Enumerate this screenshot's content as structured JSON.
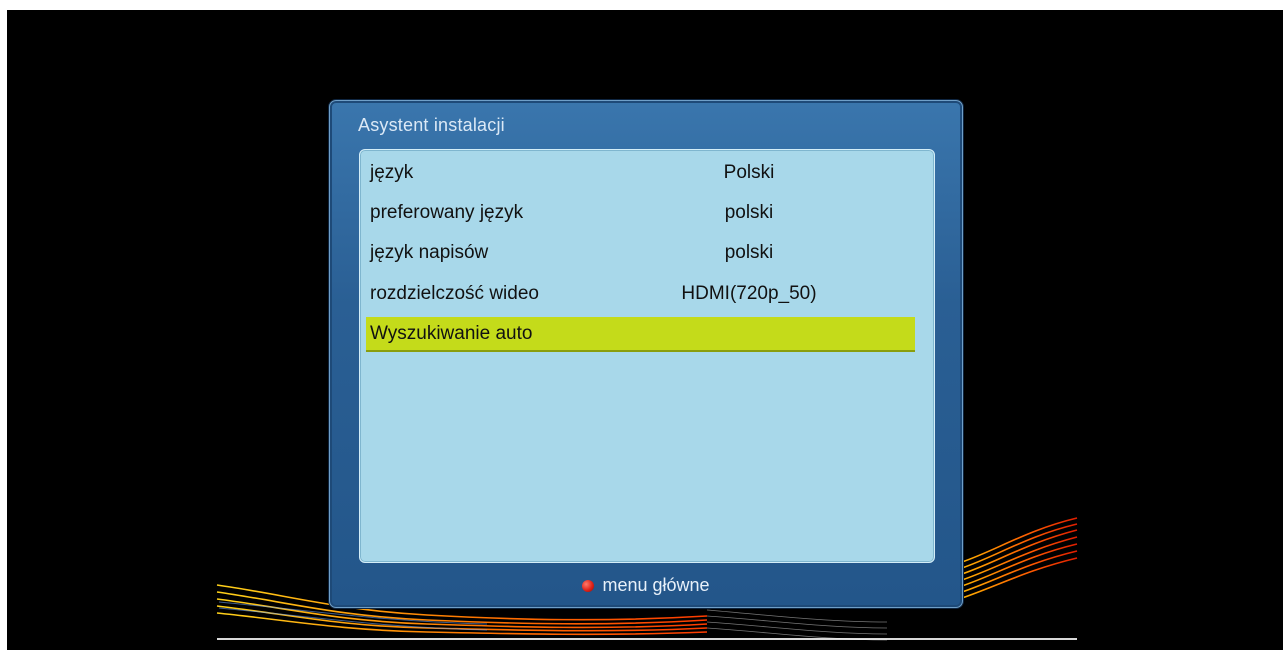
{
  "window": {
    "title": "Asystent instalacji"
  },
  "menu": {
    "items": [
      {
        "label": "język",
        "value": "Polski"
      },
      {
        "label": "preferowany język",
        "value": "polski"
      },
      {
        "label": "język napisów",
        "value": "polski"
      },
      {
        "label": "rozdzielczość wideo",
        "value": "HDMI(720p_50)"
      },
      {
        "label": "Wyszukiwanie auto",
        "value": "",
        "selected": true
      }
    ]
  },
  "footer": {
    "button_color": "red",
    "label": "menu główne"
  },
  "colors": {
    "window_frame": "#2a5f94",
    "panel": "#a8d8ea",
    "highlight": "#c4db1a",
    "red_key": "#e0231a"
  }
}
